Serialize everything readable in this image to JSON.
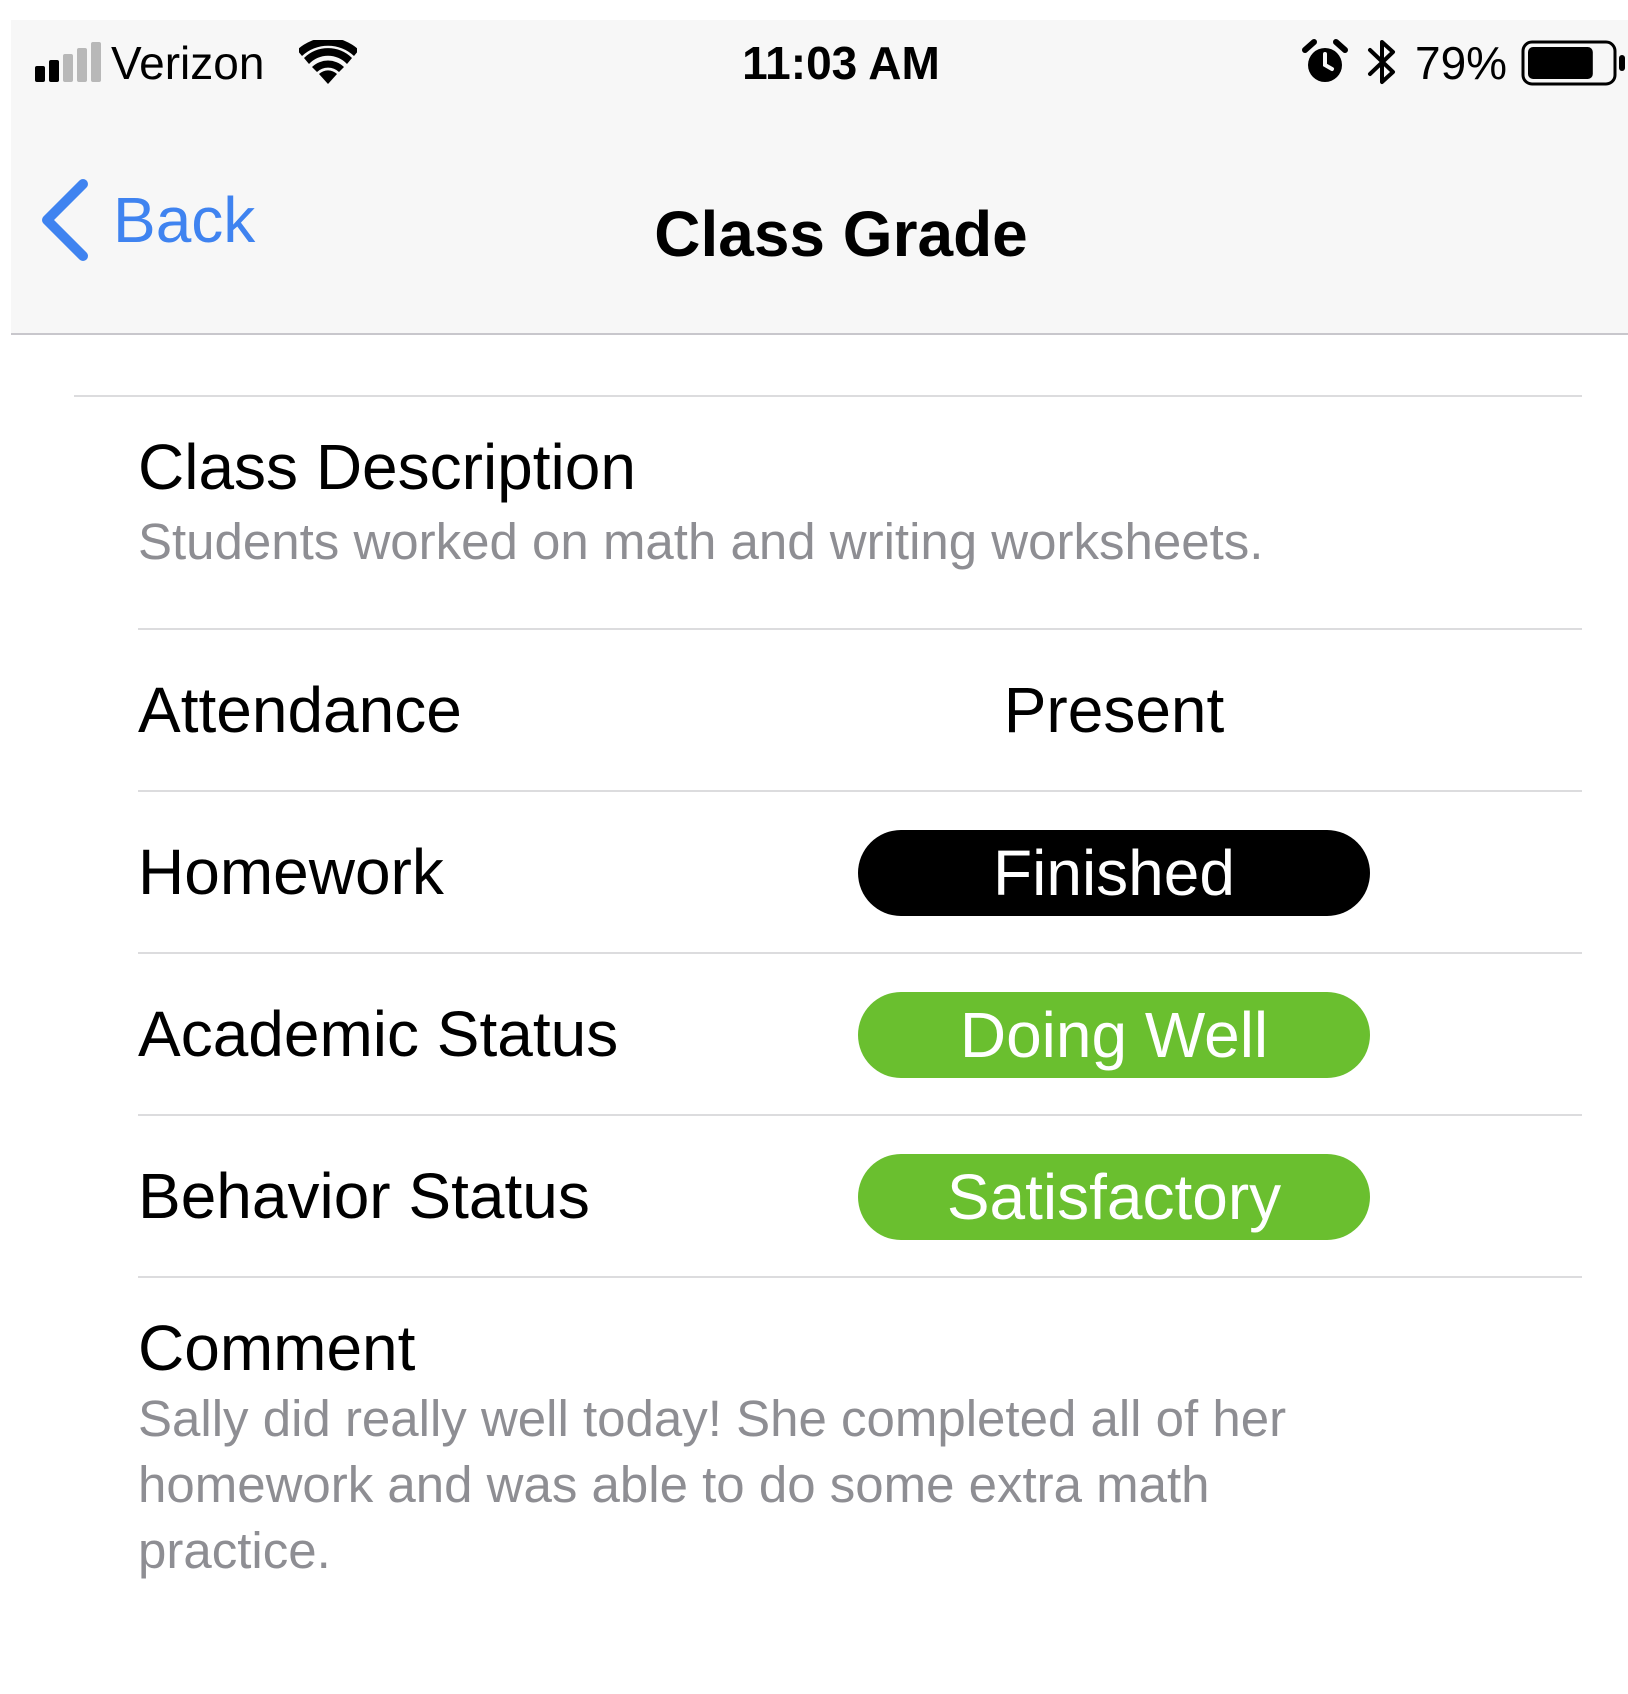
{
  "status_bar": {
    "carrier": "Verizon",
    "time": "11:03 AM",
    "battery_percent": "79%",
    "battery_level": 0.79,
    "signal_bars": 2,
    "icons": [
      "signal-icon",
      "wifi-icon",
      "alarm-icon",
      "bluetooth-icon",
      "battery-icon"
    ]
  },
  "nav": {
    "back_label": "Back",
    "title": "Class Grade",
    "accent_color": "#3f83f0"
  },
  "class_description": {
    "label": "Class Description",
    "text": "Students worked on math and writing worksheets."
  },
  "attendance": {
    "label": "Attendance",
    "value": "Present"
  },
  "homework": {
    "label": "Homework",
    "value": "Finished",
    "color": "#000000"
  },
  "academic_status": {
    "label": "Academic Status",
    "value": "Doing Well",
    "color": "#6abf2f"
  },
  "behavior_status": {
    "label": "Behavior Status",
    "value": "Satisfactory",
    "color": "#6abf2f"
  },
  "comment": {
    "label": "Comment",
    "text": "Sally did really well today! She completed all of her homework and was able to do some extra math practice."
  }
}
